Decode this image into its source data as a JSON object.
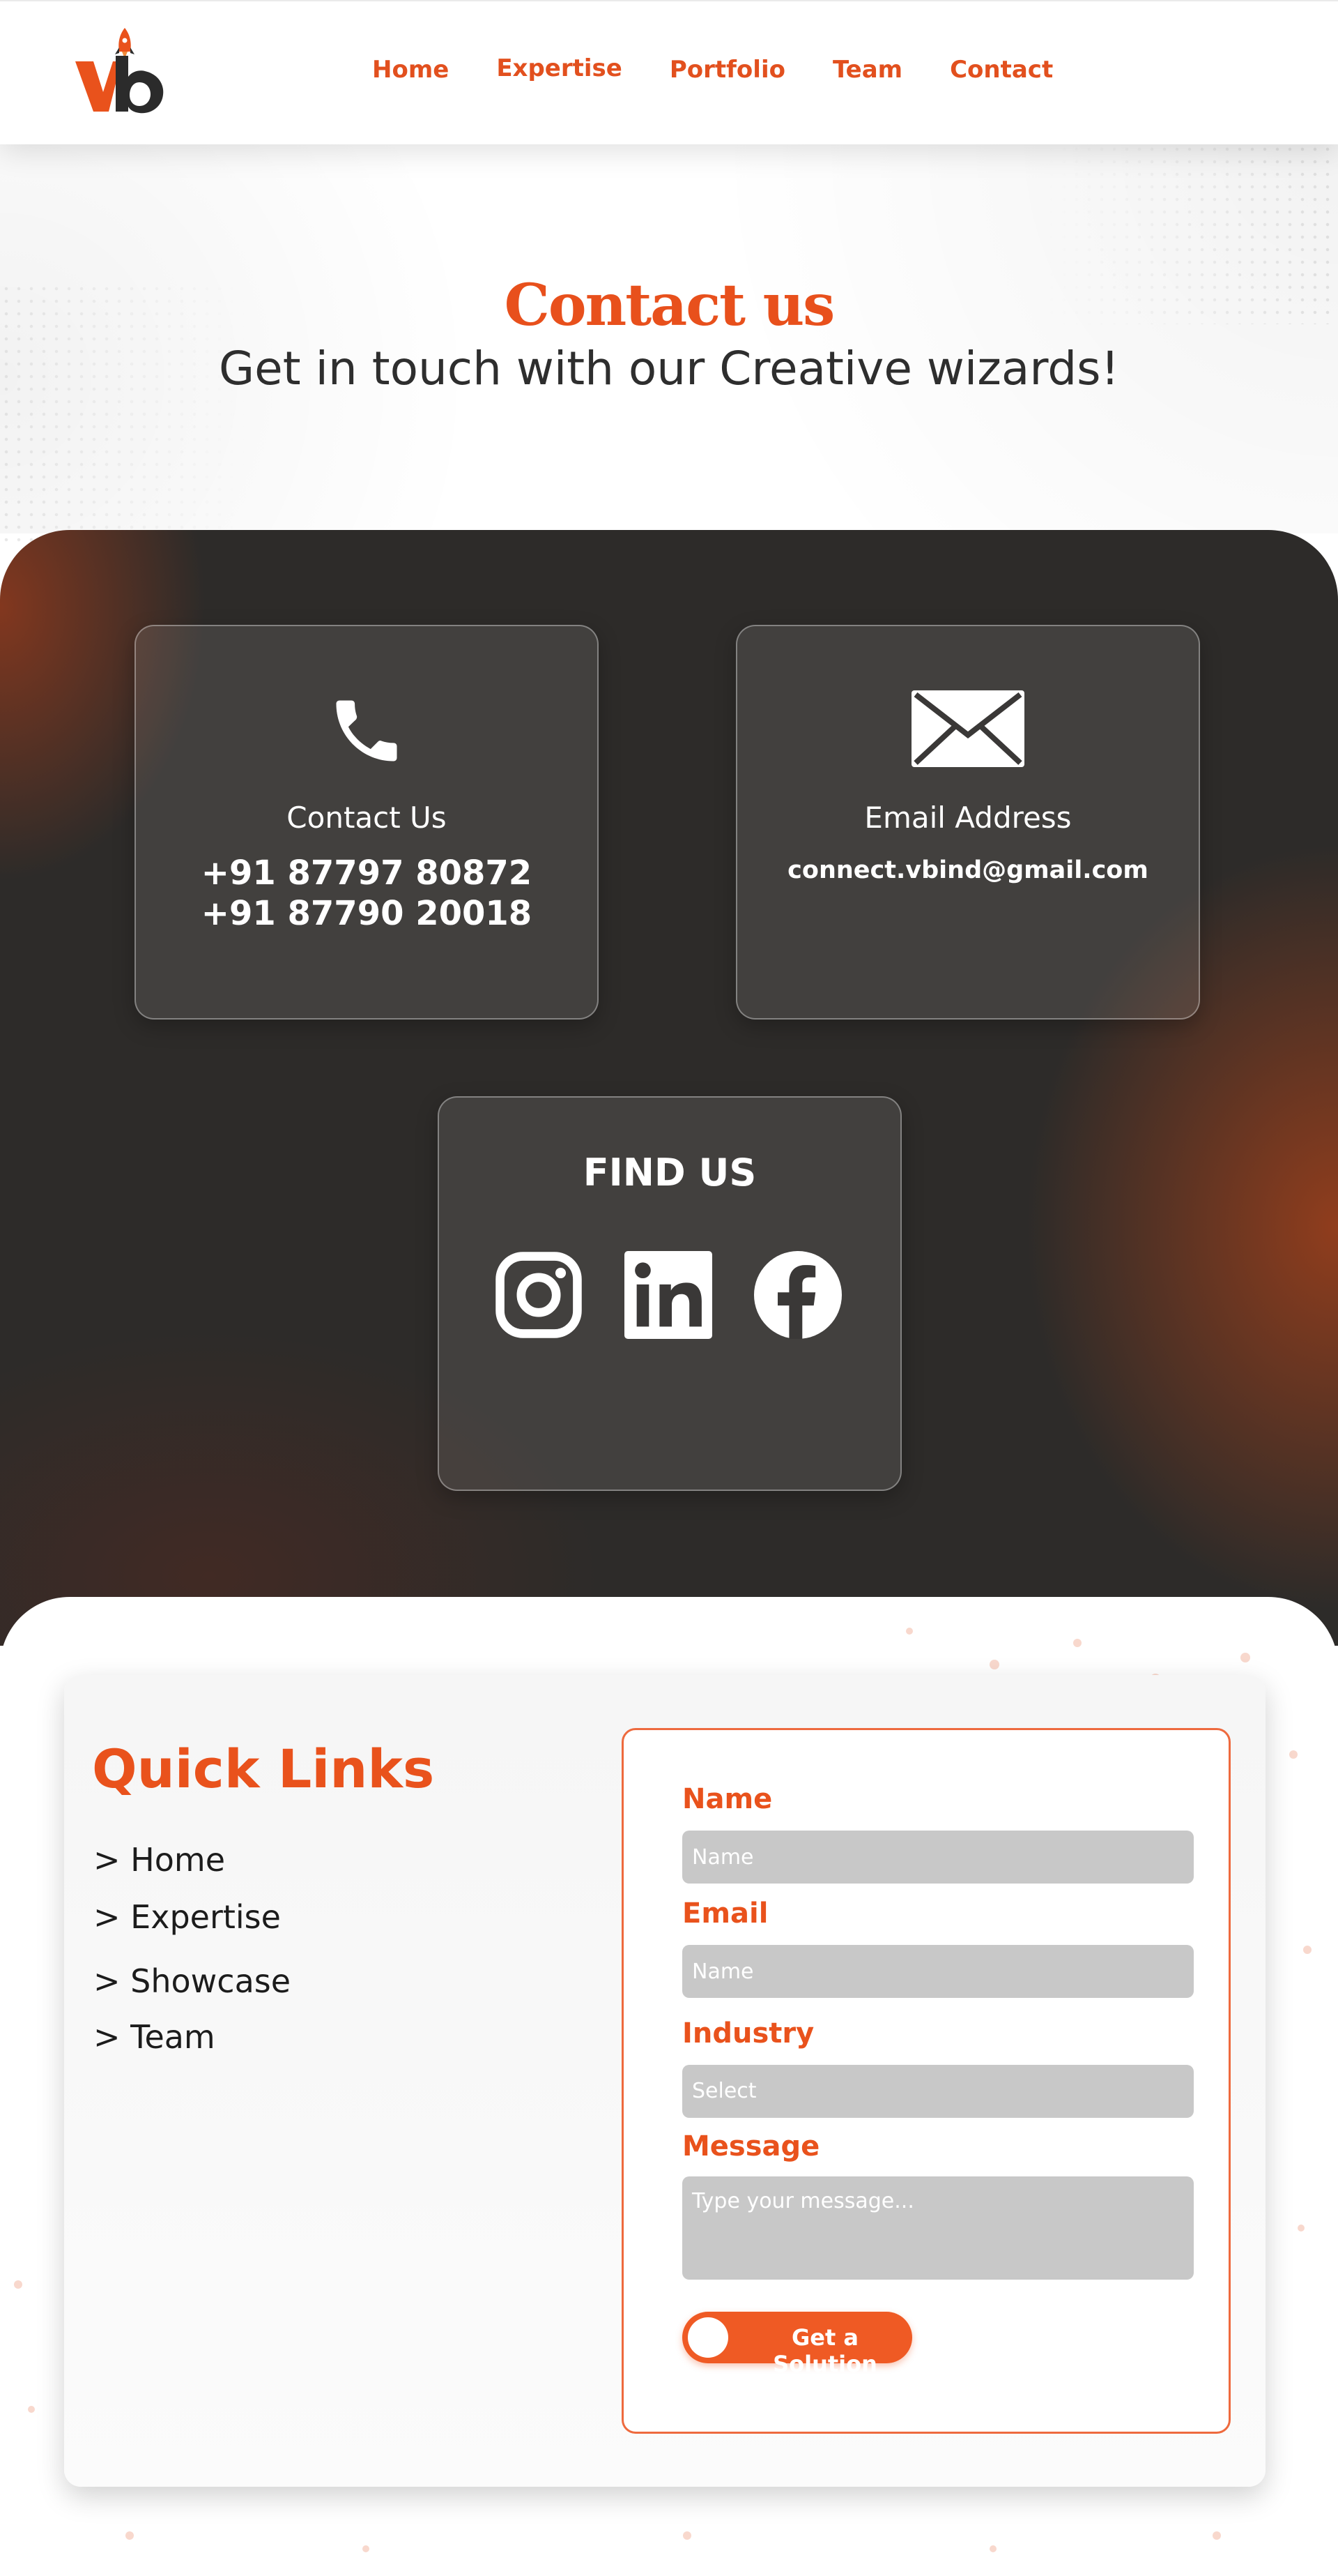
{
  "brand": {
    "logo_text": "vb",
    "accent": "#e8501c",
    "dark": "#2d2b29"
  },
  "nav": [
    {
      "label": "Home"
    },
    {
      "label": "Expertise"
    },
    {
      "label": "Portfolio"
    },
    {
      "label": "Team"
    },
    {
      "label": "Contact"
    }
  ],
  "hero": {
    "title": "Contact us",
    "subtitle": "Get in touch with our Creative wizards!"
  },
  "contact": {
    "phone_label": "Contact Us",
    "phones": [
      "+91 87797 80872",
      "+91 87790 20018"
    ],
    "email_label": "Email Address",
    "email": "connect.vbind@gmail.com",
    "find_title": "FIND US",
    "socials": [
      {
        "icon": "instagram-icon"
      },
      {
        "icon": "linkedin-icon"
      },
      {
        "icon": "facebook-icon"
      }
    ]
  },
  "footer": {
    "quick_links_title": "Quick Links",
    "quick_links": [
      "> Home",
      "> Expertise",
      "> Showcase",
      "> Team"
    ],
    "form": {
      "name_label": "Name",
      "name_placeholder": "Name",
      "email_label": "Email",
      "email_placeholder": "Name",
      "industry_label": "Industry",
      "industry_value": "Select",
      "message_label": "Message",
      "message_placeholder": "Type your message...",
      "submit_label": "Get a Solution"
    }
  }
}
